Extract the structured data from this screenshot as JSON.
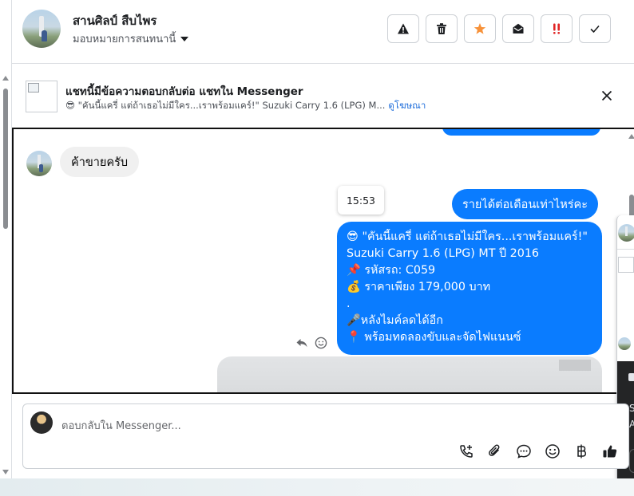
{
  "header": {
    "name": "สานศิลป์ สืบไพร",
    "assign_label": "มอบหมายการสนทนานี้",
    "actions": [
      {
        "name": "report-button",
        "icon": "warning-icon"
      },
      {
        "name": "delete-button",
        "icon": "trash-icon"
      },
      {
        "name": "star-button",
        "icon": "star-icon"
      },
      {
        "name": "mark-unread-button",
        "icon": "envelope-open-icon"
      },
      {
        "name": "priority-button",
        "icon": "exclamation-icon"
      },
      {
        "name": "done-button",
        "icon": "check-icon"
      }
    ]
  },
  "notice": {
    "title": "แชทนี้มีข้อความตอบกลับต่อ แชทใน Messenger",
    "subtitle": "😎 \"คันนี้แครี่ แต่ถ้าเธอไม่มีใคร...เราพร้อมแคร์!\" Suzuki Carry 1.6 (LPG) M...",
    "link": "ดูโฆษณา"
  },
  "chat": {
    "incoming": "ค้าขายครับ",
    "time": "15:53",
    "outgoing1": "รายได้ต่อเดือนเท่าไหร่คะ",
    "outgoing2_lines": [
      "😎 \"คันนี้แครี่ แต่ถ้าเธอไม่มีใคร...เราพร้อมแคร์!\"",
      "Suzuki Carry 1.6 (LPG) MT ปี 2016",
      "📌 รหัสรถ: C059",
      "💰 ราคาเพียง 179,000 บาท",
      ".",
      "🎤หลังไมค์ลดได้อีก",
      "📍 พร้อมทดลองขับและจัดไฟแนนซ์"
    ]
  },
  "sliver": {
    "s": "S",
    "a": "A"
  },
  "composer": {
    "placeholder": "ตอบกลับใน Messenger..."
  },
  "colors": {
    "accent": "#0a7cff",
    "star": "#f7923a",
    "priority": "#e02424"
  }
}
